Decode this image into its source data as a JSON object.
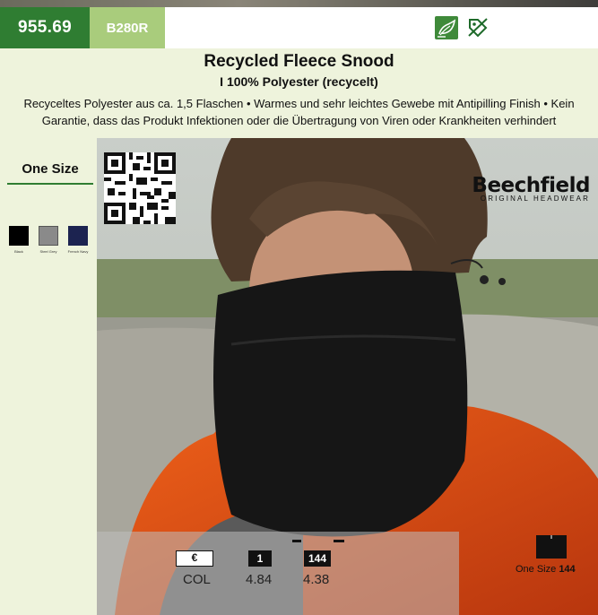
{
  "header": {
    "article_number": "955.69",
    "model_code": "B280R",
    "eco_icon": "recycled-leaf-icon",
    "tag_icon": "no-label-tag-icon"
  },
  "product": {
    "title": "Recycled Fleece Snood",
    "material": "I 100% Polyester (recycelt)",
    "description": "Recyceltes Polyester aus ca. 1,5 Flaschen • Warmes und sehr leichtes Gewebe mit Antipilling Finish • Kein Garantie, dass das Produkt Infektionen oder die Übertragung von Viren oder Krankheiten verhindert"
  },
  "sizes": {
    "heading": "One Size"
  },
  "colors": [
    {
      "name": "Black",
      "hex": "#000000"
    },
    {
      "name": "Steel Grey",
      "hex": "#8a8a8a"
    },
    {
      "name": "French Navy",
      "hex": "#1c2350"
    }
  ],
  "brand": {
    "name": "Beechfield",
    "tagline": "ORIGINAL HEADWEAR"
  },
  "pricing": {
    "currency_symbol": "€",
    "qty_1_label": "1",
    "qty_144_label": "144",
    "row_label": "COL",
    "price_qty_1": "4.84",
    "price_qty_144": "4.38"
  },
  "packaging": {
    "size_label": "One Size",
    "quantity": "144"
  }
}
